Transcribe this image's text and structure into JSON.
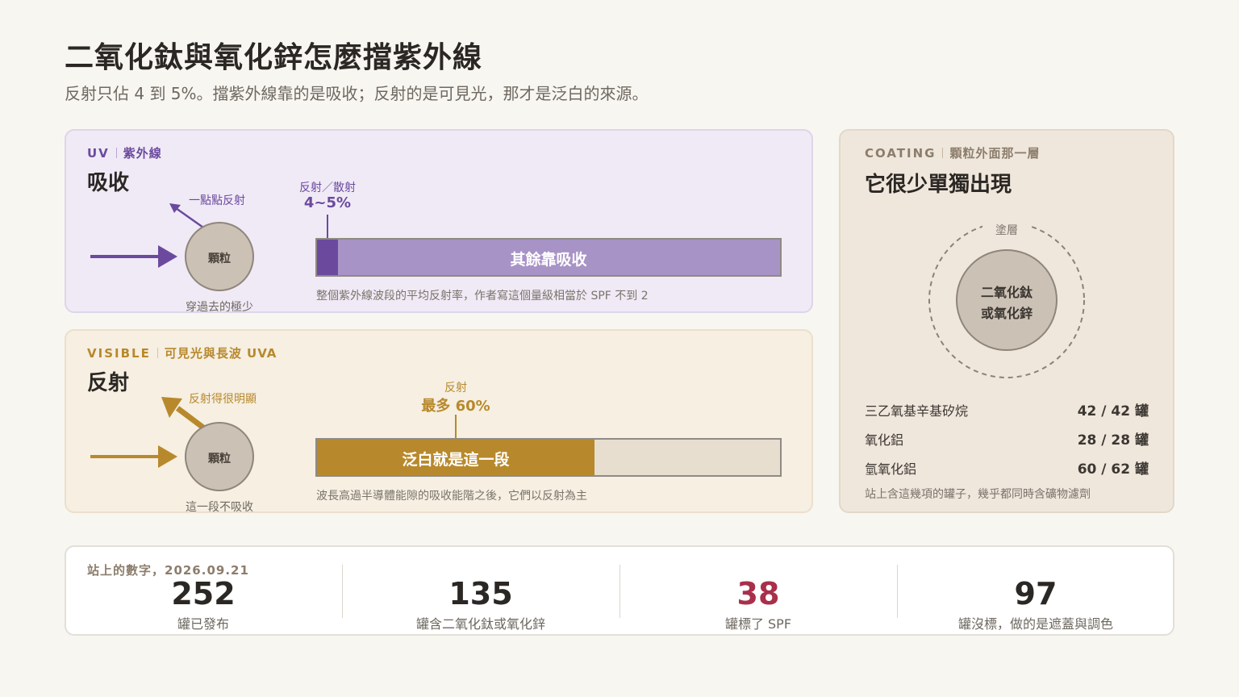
{
  "title": "二氧化鈦與氧化鋅怎麼擋紫外線",
  "subtitle": "反射只佔 4 到 5%。擋紫外線靠的是吸收；反射的是可見光，那才是泛白的來源。",
  "uv": {
    "eyebrow": "UV",
    "eyebrow_sub": "紫外線",
    "heading": "吸收",
    "reflect_label": "一點點反射",
    "particle": "顆粒",
    "through_label": "穿過去的極少",
    "marker_label": "反射／散射",
    "marker_value": "4~5%",
    "bar_label": "其餘靠吸收",
    "reflect_fraction": 0.045,
    "note": "整個紫外線波段的平均反射率，作者寫這個量級相當於 SPF 不到 2"
  },
  "visible": {
    "eyebrow": "VISIBLE",
    "eyebrow_sub": "可見光與長波 UVA",
    "heading": "反射",
    "reflect_label": "反射得很明顯",
    "particle": "顆粒",
    "through_label": "這一段不吸收",
    "marker_label": "反射",
    "marker_value": "最多 60%",
    "bar_label": "泛白就是這一段",
    "reflect_fraction": 0.6,
    "note": "波長高過半導體能隙的吸收能階之後，它們以反射為主"
  },
  "coating": {
    "eyebrow": "COATING",
    "eyebrow_sub": "顆粒外面那一層",
    "heading": "它很少單獨出現",
    "shell_label": "塗層",
    "core_line1": "二氧化鈦",
    "core_line2": "或氧化鋅",
    "rows": [
      {
        "name": "三乙氧基辛基矽烷",
        "value": "42 / 42 罐"
      },
      {
        "name": "氧化鋁",
        "value": "28 / 28 罐"
      },
      {
        "name": "氫氧化鋁",
        "value": "60 / 62 罐"
      }
    ],
    "note": "站上含這幾項的罐子，幾乎都同時含礦物濾劑"
  },
  "stats": {
    "caption": "站上的數字，2026.09.21",
    "items": [
      {
        "value": "252",
        "label": "罐已發布"
      },
      {
        "value": "135",
        "label": "罐含二氧化鈦或氧化鋅"
      },
      {
        "value": "38",
        "label": "罐標了 SPF"
      },
      {
        "value": "97",
        "label": "罐沒標，做的是遮蓋與調色"
      }
    ]
  },
  "colors": {
    "uv_accent": "#6b4a9e",
    "uv_bar": "#a893c6",
    "vis_accent": "#b8892c",
    "vis_bar_empty": "#e8ded0",
    "coat_accent": "#8c7d6c",
    "highlight": "#a8304a",
    "particle": "#cbc1b5"
  }
}
